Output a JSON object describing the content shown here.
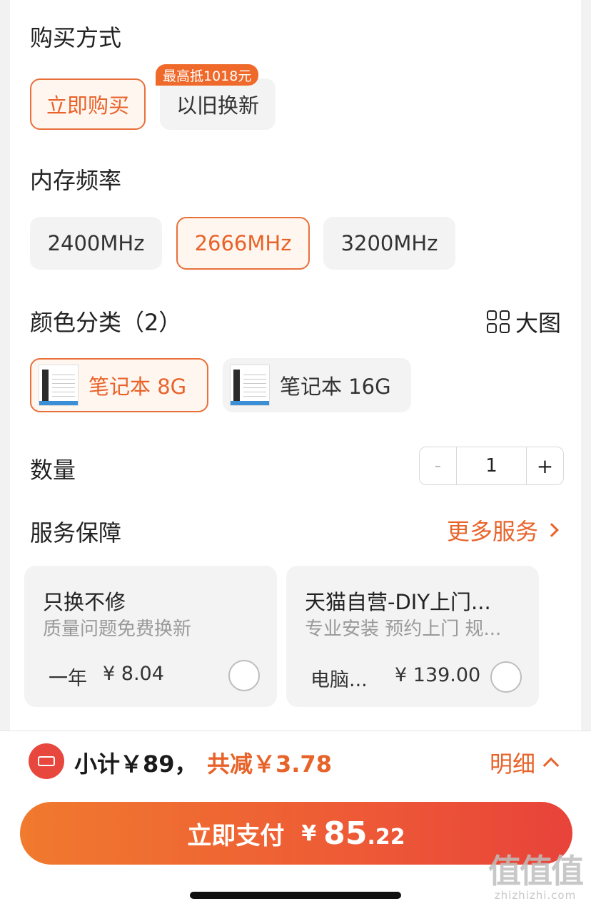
{
  "purchase": {
    "title": "购买方式",
    "options": [
      "立即购买",
      "以旧换新"
    ],
    "promo_tag": "最高抵1018元"
  },
  "memory": {
    "title": "内存频率",
    "options": [
      "2400MHz",
      "2666MHz",
      "3200MHz"
    ]
  },
  "color": {
    "title": "颜色分类（2）",
    "big_view": "大图",
    "options": [
      "笔记本 8G",
      "笔记本 16G"
    ]
  },
  "quantity": {
    "title": "数量",
    "minus": "-",
    "value": "1",
    "plus": "+"
  },
  "services": {
    "title": "服务保障",
    "more": "更多服务",
    "cards": [
      {
        "title": "只换不修",
        "subtitle": "质量问题免费换新",
        "term": "一年",
        "price": "¥ 8.04"
      },
      {
        "title": "天猫自营-DIY上门...",
        "subtitle": "专业安装 预约上门 规...",
        "term": "电脑...",
        "price": "¥ 139.00"
      }
    ]
  },
  "summary": {
    "subtotal": "小计￥89，",
    "discount": "共减￥3.78",
    "detail": "明细"
  },
  "pay": {
    "label": "立即支付",
    "currency": "¥",
    "amount_int": "85",
    "amount_dec": ".22"
  },
  "watermark": {
    "big": "值值值",
    "small": "zhizhizhi.com"
  },
  "colors": {
    "accent": "#e8632a",
    "pay_start": "#f07a2e",
    "pay_end": "#e8433a"
  }
}
